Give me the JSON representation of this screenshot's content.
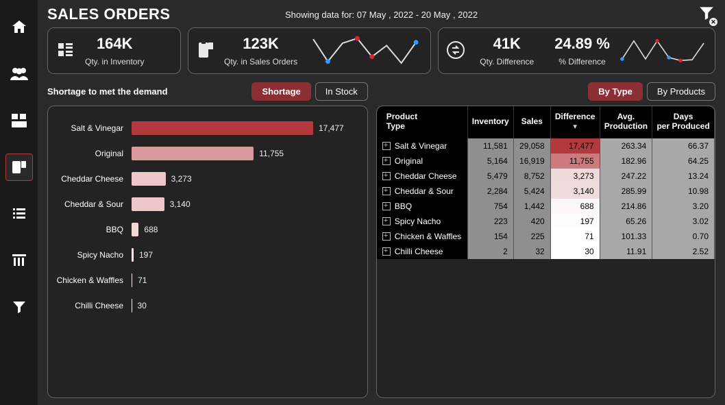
{
  "page": {
    "title": "SALES ORDERS",
    "date_range": "Showing data for: 07 May , 2022 - 20 May , 2022"
  },
  "nav": {
    "items": [
      {
        "name": "home-icon"
      },
      {
        "name": "people-icon"
      },
      {
        "name": "inventory-icon"
      },
      {
        "name": "orders-icon",
        "active": true
      },
      {
        "name": "list-icon"
      },
      {
        "name": "columns-icon"
      },
      {
        "name": "filter-icon"
      }
    ]
  },
  "kpi": {
    "inventory": {
      "value": "164K",
      "label": "Qty. in Inventory"
    },
    "sales": {
      "value": "123K",
      "label": "Qty. in Sales Orders"
    },
    "diff": {
      "value": "41K",
      "label": "Qty. Difference"
    },
    "pct": {
      "value": "24.89 %",
      "label": "% Difference"
    }
  },
  "section_tabs": {
    "left_title": "Shortage to met the demand",
    "left": [
      {
        "label": "Shortage",
        "active": true
      },
      {
        "label": "In Stock",
        "active": false
      }
    ],
    "right": [
      {
        "label": "By Type",
        "active": true
      },
      {
        "label": "By Products",
        "active": false
      }
    ]
  },
  "table": {
    "columns": [
      "Product Type",
      "Inventory",
      "Sales",
      "Difference",
      "Avg. Production",
      "Days per Produced"
    ],
    "sort_col": "Difference",
    "rows": [
      {
        "type": "Salt & Vinegar",
        "inv": "11,581",
        "sales": "29,058",
        "diff": "17,477",
        "diff_n": 17477,
        "avg": "263.34",
        "days": "66.37"
      },
      {
        "type": "Original",
        "inv": "5,164",
        "sales": "16,919",
        "diff": "11,755",
        "diff_n": 11755,
        "avg": "182.96",
        "days": "64.25"
      },
      {
        "type": "Cheddar Cheese",
        "inv": "5,479",
        "sales": "8,752",
        "diff": "3,273",
        "diff_n": 3273,
        "avg": "247.22",
        "days": "13.24"
      },
      {
        "type": "Cheddar & Sour",
        "inv": "2,284",
        "sales": "5,424",
        "diff": "3,140",
        "diff_n": 3140,
        "avg": "285.99",
        "days": "10.98"
      },
      {
        "type": "BBQ",
        "inv": "754",
        "sales": "1,442",
        "diff": "688",
        "diff_n": 688,
        "avg": "214.86",
        "days": "3.20"
      },
      {
        "type": "Spicy Nacho",
        "inv": "223",
        "sales": "420",
        "diff": "197",
        "diff_n": 197,
        "avg": "65.26",
        "days": "3.02"
      },
      {
        "type": "Chicken & Waffles",
        "inv": "154",
        "sales": "225",
        "diff": "71",
        "diff_n": 71,
        "avg": "101.33",
        "days": "0.70"
      },
      {
        "type": "Chilli Cheese",
        "inv": "2",
        "sales": "32",
        "diff": "30",
        "diff_n": 30,
        "avg": "11.91",
        "days": "2.52"
      }
    ]
  },
  "chart_data": {
    "type": "bar",
    "title": "Shortage to met the demand",
    "xlabel": "",
    "ylabel": "",
    "orientation": "horizontal",
    "categories": [
      "Salt & Vinegar",
      "Original",
      "Cheddar Cheese",
      "Cheddar & Sour",
      "BBQ",
      "Spicy Nacho",
      "Chicken & Waffles",
      "Chilli Cheese"
    ],
    "values": [
      17477,
      11755,
      3273,
      3140,
      688,
      197,
      71,
      30
    ],
    "colors": [
      "#b23a3e",
      "#da9a9d",
      "#efc6c9",
      "#efc6c9",
      "#f3d7d9",
      "#f7e6e7",
      "#f9eeef",
      "#faf2f3"
    ],
    "xlim": [
      0,
      17500
    ]
  },
  "sparklines": {
    "sales": {
      "points": [
        38,
        10,
        33,
        39,
        16,
        30,
        8,
        34
      ],
      "markers": {
        "red": [
          3,
          4
        ],
        "blue": [
          1,
          7
        ]
      }
    },
    "diff": {
      "points": [
        12,
        36,
        12,
        36,
        14,
        10,
        11,
        33
      ],
      "markers": {
        "red": [
          3,
          5
        ],
        "blue": [
          0,
          4
        ]
      }
    }
  },
  "colors": {
    "accent": "#8c2f34",
    "diff_heat_max": "#b23a3e",
    "diff_heat_min": "#ffffff"
  }
}
